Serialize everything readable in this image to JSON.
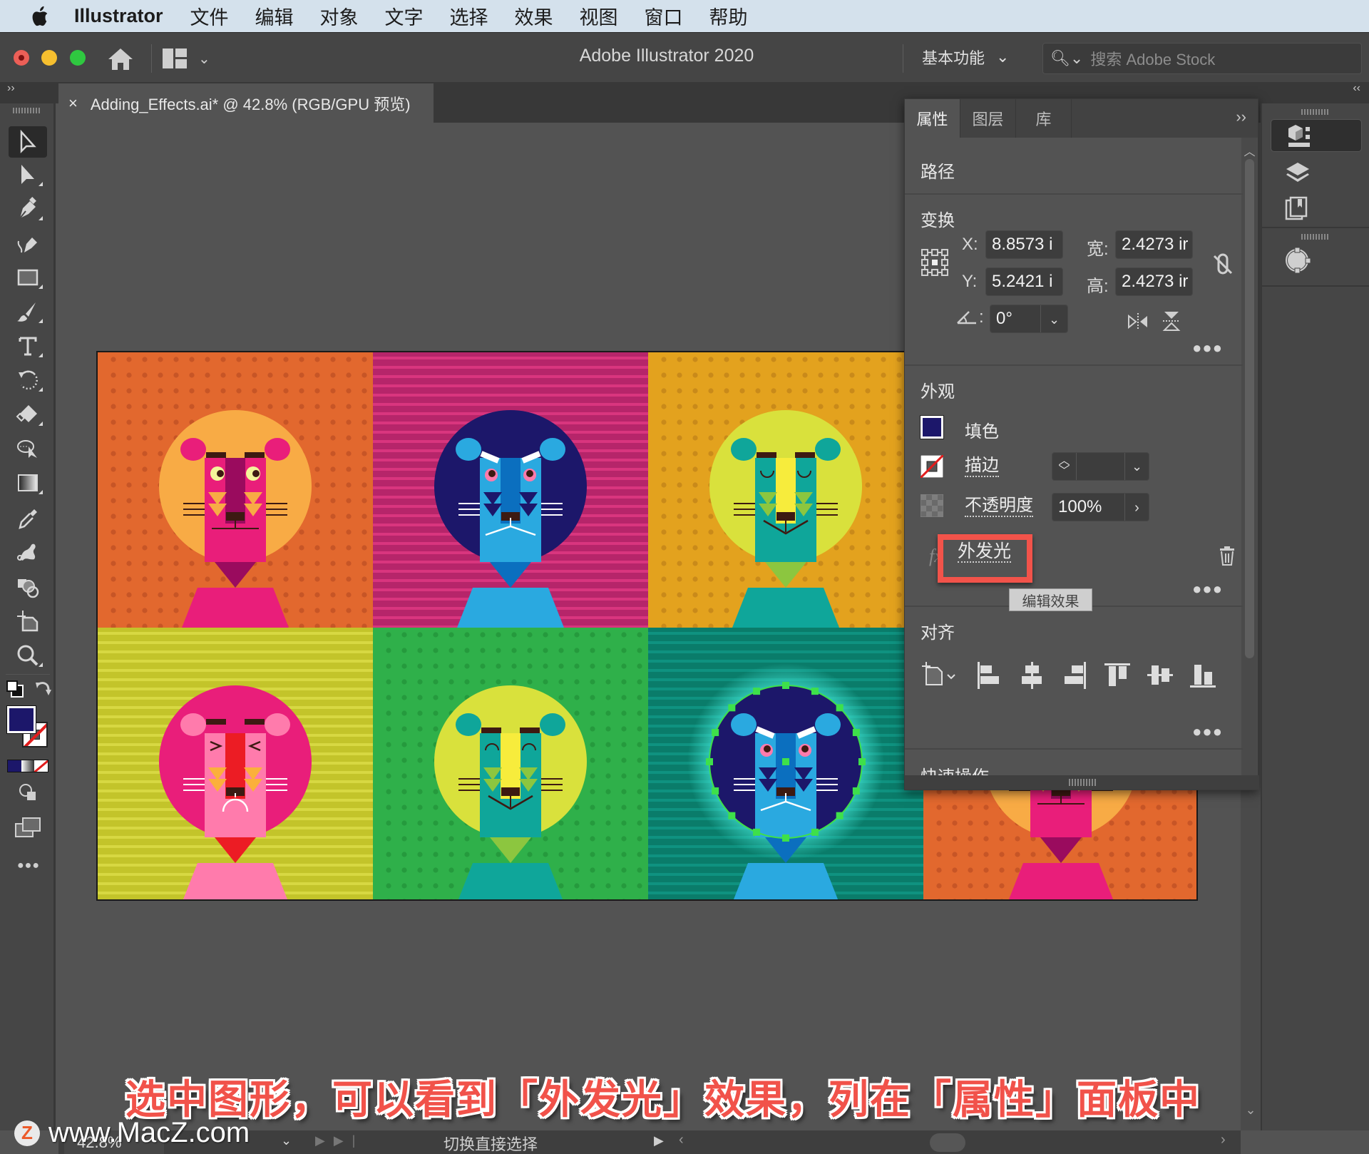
{
  "menubar": {
    "app_name": "Illustrator",
    "items": [
      "文件",
      "编辑",
      "对象",
      "文字",
      "选择",
      "效果",
      "视图",
      "窗口",
      "帮助"
    ]
  },
  "titlebar": {
    "title": "Adobe Illustrator 2020",
    "workspace": "基本功能",
    "stock_search_placeholder": "搜索 Adobe Stock"
  },
  "document_tab": {
    "close": "×",
    "label": "Adding_Effects.ai* @ 42.8% (RGB/GPU 预览)"
  },
  "dock_toggles": {
    "left": "››",
    "right": "‹‹"
  },
  "tools": [
    {
      "name": "selection-tool",
      "selected": true
    },
    {
      "name": "direct-selection-tool"
    },
    {
      "name": "pen-tool"
    },
    {
      "name": "curvature-tool"
    },
    {
      "name": "rectangle-tool"
    },
    {
      "name": "paintbrush-tool"
    },
    {
      "name": "type-tool"
    },
    {
      "name": "rotate-tool"
    },
    {
      "name": "eraser-tool"
    },
    {
      "name": "puppet-warp-tool"
    },
    {
      "name": "gradient-tool"
    },
    {
      "name": "eyedropper-tool"
    },
    {
      "name": "blend-tool"
    },
    {
      "name": "shape-builder-tool"
    },
    {
      "name": "artboard-tool"
    },
    {
      "name": "zoom-tool"
    }
  ],
  "colors": {
    "fill": "#1c176a",
    "stroke": "none",
    "accent_highlight": "#f2534a",
    "selection": "#3ee04a"
  },
  "properties_panel": {
    "tabs": [
      {
        "label": "属性",
        "active": true
      },
      {
        "label": "图层",
        "active": false
      },
      {
        "label": "库",
        "active": false
      }
    ],
    "object_type": "路径",
    "transform": {
      "title": "变换",
      "x_label": "X:",
      "x_value": "8.8573 i",
      "y_label": "Y:",
      "y_value": "5.2421 i",
      "w_label": "宽:",
      "w_value": "2.4273 ir",
      "h_label": "高:",
      "h_value": "2.4273 ir",
      "angle_label": ":",
      "angle_value": "0°"
    },
    "appearance": {
      "title": "外观",
      "fill_label": "填色",
      "stroke_label": "描边",
      "opacity_label": "不透明度",
      "opacity_value": "100%",
      "effect_prefix": "fx",
      "effect_name": "外发光",
      "tooltip": "编辑效果"
    },
    "align": {
      "title": "对齐"
    },
    "quick_actions": {
      "title": "快速操作"
    }
  },
  "artwork": {
    "cells": [
      {
        "bg": "#e2682e",
        "pattern": "dots",
        "dot": "#c75526",
        "mane": "#f8ab45",
        "face": "#e91e7a",
        "nose_bridge": "#9a0b5e",
        "ears": "#e91e7a",
        "body": "#e91e7a",
        "chin": "#9a0b5e",
        "eyes": "open",
        "mouth": "flat",
        "accent": "#f8ab45",
        "whisker": "#3d1a12"
      },
      {
        "bg": "#b6256a",
        "pattern": "stripes",
        "dot": "#d9357e",
        "mane": "#1c176a",
        "face": "#2aa9e0",
        "nose_bridge": "#0b6fbf",
        "ears": "#2aa9e0",
        "body": "#2aa9e0",
        "chin": "#0b6fbf",
        "eyes": "angry",
        "mouth": "frown",
        "accent": "#1c176a",
        "whisker": "#ffffff"
      },
      {
        "bg": "#e3a21e",
        "pattern": "dots",
        "dot": "#c98a1a",
        "mane": "#d9e13c",
        "face": "#0fa69a",
        "nose_bridge": "#f7ec3c",
        "ears": "#0fa69a",
        "body": "#0fa69a",
        "chin": "#8cc63f",
        "eyes": "closed",
        "mouth": "smile",
        "accent": "#8cc63f",
        "whisker": "#3d1a12"
      },
      {
        "bg": "#c3c42a",
        "pattern": "stripes",
        "dot": "#d7d842",
        "mane": "#e91e7a",
        "face": "#ff7bac",
        "nose_bridge": "#ec1c24",
        "ears": "#ff7bac",
        "body": "#ff7bac",
        "chin": "#ec1c24",
        "eyes": "squint",
        "mouth": "sad",
        "accent": "#fbb03b",
        "whisker": "#ffffff"
      },
      {
        "bg": "#2fb04a",
        "pattern": "dots",
        "dot": "#259a3d",
        "mane": "#d9e13c",
        "face": "#0fa69a",
        "nose_bridge": "#f7ec3c",
        "ears": "#0fa69a",
        "body": "#0fa69a",
        "chin": "#8cc63f",
        "eyes": "happy",
        "mouth": "smile",
        "accent": "#8cc63f",
        "whisker": "#3d1a12"
      },
      {
        "bg": "#0a7c6a",
        "pattern": "stripes",
        "dot": "#0f9280",
        "mane": "#1c176a",
        "face": "#2aa9e0",
        "nose_bridge": "#0b6fbf",
        "ears": "#2aa9e0",
        "body": "#2aa9e0",
        "chin": "#0b6fbf",
        "eyes": "angry",
        "mouth": "frown",
        "accent": "#1c176a",
        "whisker": "#ffffff",
        "selected": true,
        "glow": true
      },
      {
        "bg": "#e2682e",
        "pattern": "dots",
        "dot": "#c75526",
        "mane": "#f8ab45",
        "face": "#e91e7a",
        "nose_bridge": "#9a0b5e",
        "ears": "#e91e7a",
        "body": "#e91e7a",
        "chin": "#9a0b5e",
        "eyes": "open",
        "mouth": "flat",
        "accent": "#f8ab45",
        "whisker": "#3d1a12",
        "partial": true
      }
    ]
  },
  "statusbar": {
    "zoom": "42.8%",
    "current_tool": "切换直接选择"
  },
  "caption": "选中图形，可以看到「外发光」效果，列在「属性」面板中",
  "watermark": "www.MacZ.com"
}
